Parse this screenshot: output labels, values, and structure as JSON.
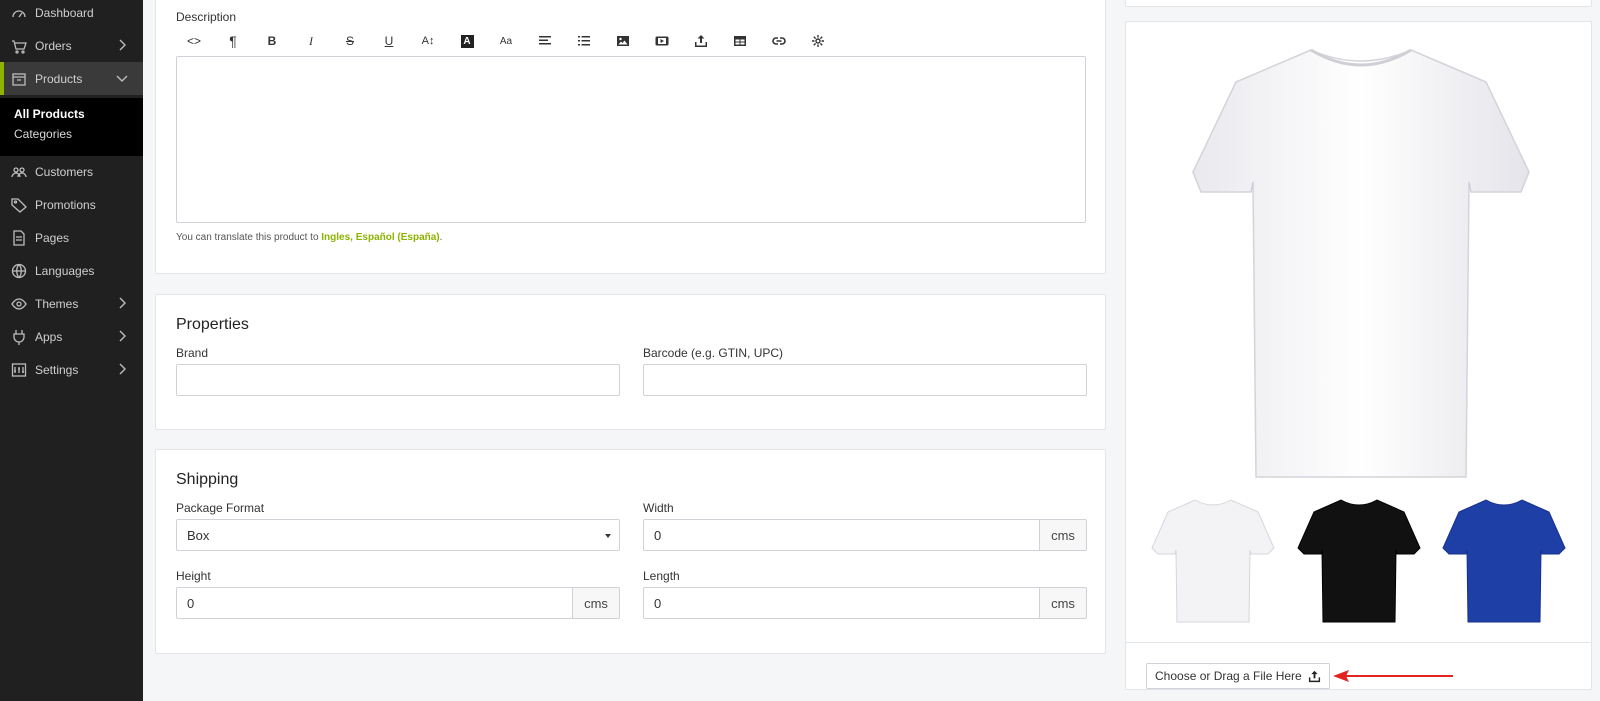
{
  "sidebar": {
    "items": [
      {
        "label": "Dashboard",
        "icon": "dashboard-icon",
        "chevron": false
      },
      {
        "label": "Orders",
        "icon": "orders-icon",
        "chevron": true
      },
      {
        "label": "Products",
        "icon": "products-icon",
        "chevron": true,
        "expanded": true
      },
      {
        "label": "Customers",
        "icon": "customers-icon",
        "chevron": false
      },
      {
        "label": "Promotions",
        "icon": "tag-icon",
        "chevron": false
      },
      {
        "label": "Pages",
        "icon": "page-icon",
        "chevron": false
      },
      {
        "label": "Languages",
        "icon": "globe-icon",
        "chevron": false
      },
      {
        "label": "Themes",
        "icon": "eye-icon",
        "chevron": true
      },
      {
        "label": "Apps",
        "icon": "plug-icon",
        "chevron": true
      },
      {
        "label": "Settings",
        "icon": "settings-icon",
        "chevron": true
      }
    ],
    "products_sub": [
      "All Products",
      "Categories"
    ],
    "accent": "#8cb300"
  },
  "description": {
    "label": "Description",
    "toolbar": [
      "code-view-icon",
      "paragraph-icon",
      "bold-icon",
      "italic-icon",
      "strikethrough-icon",
      "underline-icon",
      "font-size-icon",
      "font-color-icon",
      "font-family-icon",
      "align-icon",
      "list-icon",
      "image-icon",
      "video-icon",
      "upload-icon",
      "table-icon",
      "link-icon",
      "special-char-icon"
    ],
    "toolbar_text": {
      "code": "<>",
      "paragraph": "¶",
      "bold": "B",
      "italic": "I",
      "strike": "S",
      "underline": "U",
      "font_size": "A↕",
      "font_color": "A",
      "font_family": "Aa"
    },
    "translate_prefix": "You can translate this product to ",
    "translate_links": "Ingles, Español (España)",
    "translate_suffix": "."
  },
  "properties": {
    "title": "Properties",
    "brand_label": "Brand",
    "brand_value": "",
    "barcode_label": "Barcode (e.g. GTIN, UPC)",
    "barcode_value": ""
  },
  "shipping": {
    "title": "Shipping",
    "package_format_label": "Package Format",
    "package_format_value": "Box",
    "width_label": "Width",
    "width_value": "0",
    "width_unit": "cms",
    "height_label": "Height",
    "height_value": "0",
    "height_unit": "cms",
    "length_label": "Length",
    "length_value": "0",
    "length_unit": "cms"
  },
  "images": {
    "main_color": "white",
    "thumbnails": [
      "white",
      "black",
      "blue"
    ],
    "upload_label": "Choose or Drag a File Here",
    "annotation": "red-arrow"
  }
}
